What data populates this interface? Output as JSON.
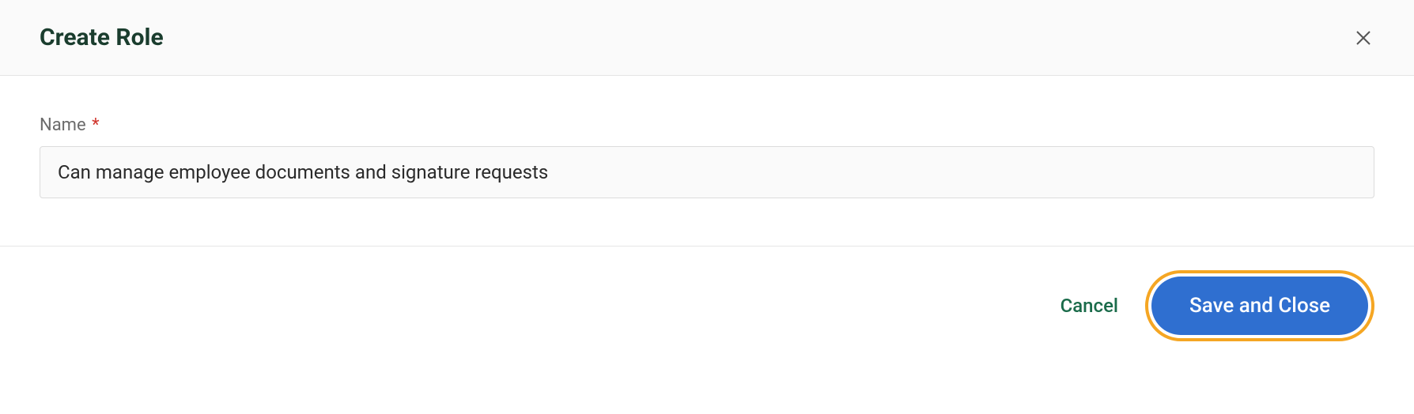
{
  "header": {
    "title": "Create Role"
  },
  "form": {
    "name_label": "Name",
    "required_mark": "*",
    "name_value": "Can manage employee documents and signature requests"
  },
  "footer": {
    "cancel_label": "Cancel",
    "save_label": "Save and Close"
  }
}
